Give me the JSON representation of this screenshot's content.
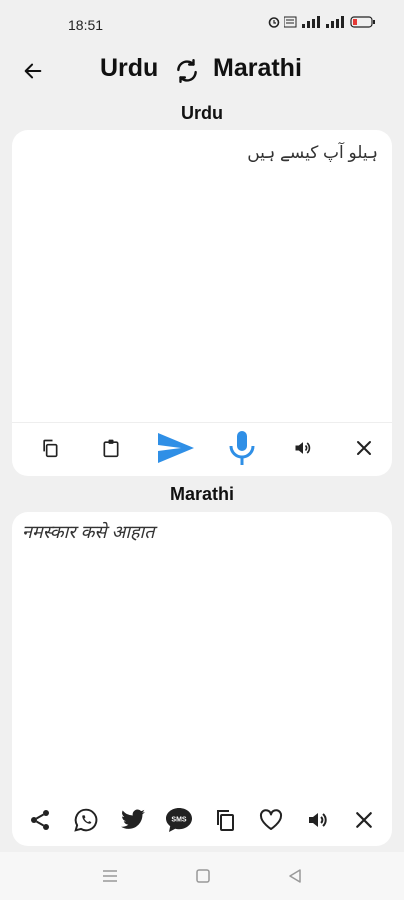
{
  "status": {
    "time": "18:51"
  },
  "header": {
    "source_lang": "Urdu",
    "target_lang": "Marathi"
  },
  "source": {
    "label": "Urdu",
    "text": "ہیلو آپ کیسے ہیں"
  },
  "target": {
    "label": "Marathi",
    "text": "नमस्कार कसे आहात"
  },
  "colors": {
    "accent": "#2f8fe6",
    "background": "#f0f0f0",
    "card": "#ffffff"
  }
}
